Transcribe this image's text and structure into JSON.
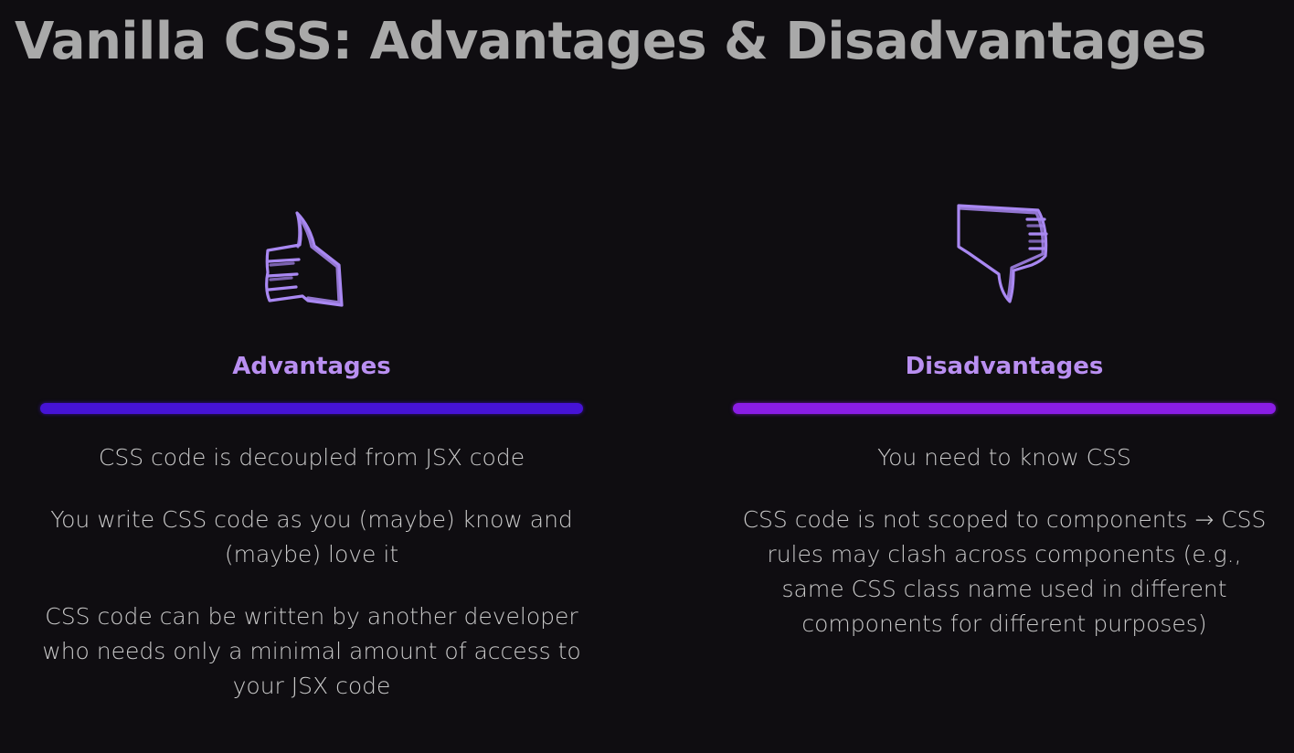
{
  "slide": {
    "title": "Vanilla CSS: Advantages & Disadvantages"
  },
  "advantages": {
    "icon": "thumbs-up-icon",
    "heading": "Advantages",
    "accent_color": "#4613d6",
    "points": [
      "CSS code is decoupled from JSX code",
      "You write CSS code as you (maybe) know and (maybe) love it",
      "CSS code can be written by another developer who needs only a minimal amount of access to your JSX code"
    ]
  },
  "disadvantages": {
    "icon": "thumbs-down-icon",
    "heading": "Disadvantages",
    "accent_color": "#8a1de6",
    "points": [
      "You need to know CSS",
      "CSS code is not scoped to components → CSS rules may clash across components (e.g., same CSS class name used in different components for different purposes)"
    ]
  },
  "colors": {
    "background": "#0f0d11",
    "title": "#a9a9a9",
    "heading": "#b98ff1",
    "body_text": "#c9c9c9"
  }
}
